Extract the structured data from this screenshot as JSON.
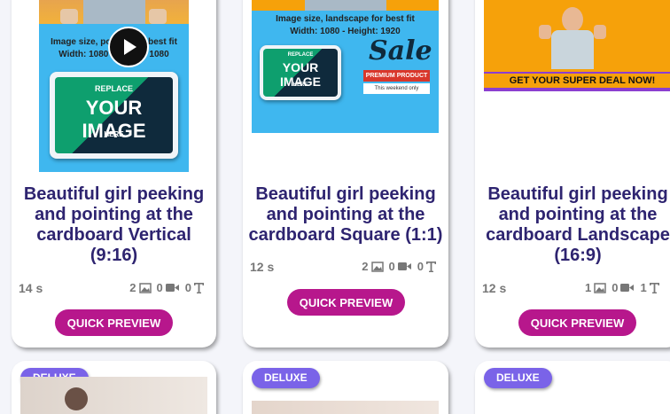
{
  "cards": [
    {
      "title": "Beautiful girl peeking and pointing at the cardboard Vertical (9:16)",
      "duration": "14 s",
      "images": "2",
      "videos": "0",
      "texts": "0",
      "button": "QUICK PREVIEW",
      "thumb": {
        "line1": "Image size, portrait for best fit",
        "line2": "Width: 1080 - Height: 1080",
        "sign_top": "REPLACE",
        "sign_main": "YOUR IMAGE",
        "sign_bottom": "HERE"
      }
    },
    {
      "title": "Beautiful girl peeking and pointing at the cardboard Square (1:1)",
      "duration": "12 s",
      "images": "2",
      "videos": "0",
      "texts": "0",
      "button": "QUICK PREVIEW",
      "thumb": {
        "line1": "Image size, landscape for best fit",
        "line2": "Width: 1080 -  Height: 1920",
        "sign_top": "REPLACE",
        "sign_main": "YOUR IMAGE",
        "sign_bottom": "HERE",
        "sale": "Sale",
        "premium": "PREMIUM PRODUCT",
        "weekend": "This weekend only"
      }
    },
    {
      "title": "Beautiful girl peeking and pointing at the cardboard Landscape (16:9)",
      "duration": "12 s",
      "images": "1",
      "videos": "0",
      "texts": "1",
      "button": "QUICK PREVIEW",
      "thumb": {
        "banner": "GET YOUR SUPER DEAL NOW!"
      }
    }
  ],
  "bottom_cards": [
    {
      "badge": "DELUXE"
    },
    {
      "badge": "DELUXE"
    },
    {
      "badge": "DELUXE"
    }
  ],
  "colors": {
    "title": "#2e2470",
    "button": "#b7178c",
    "badge": "#7a63e8",
    "thumb_blue": "#3fb7ef",
    "thumb_orange": "#f6a10a"
  }
}
